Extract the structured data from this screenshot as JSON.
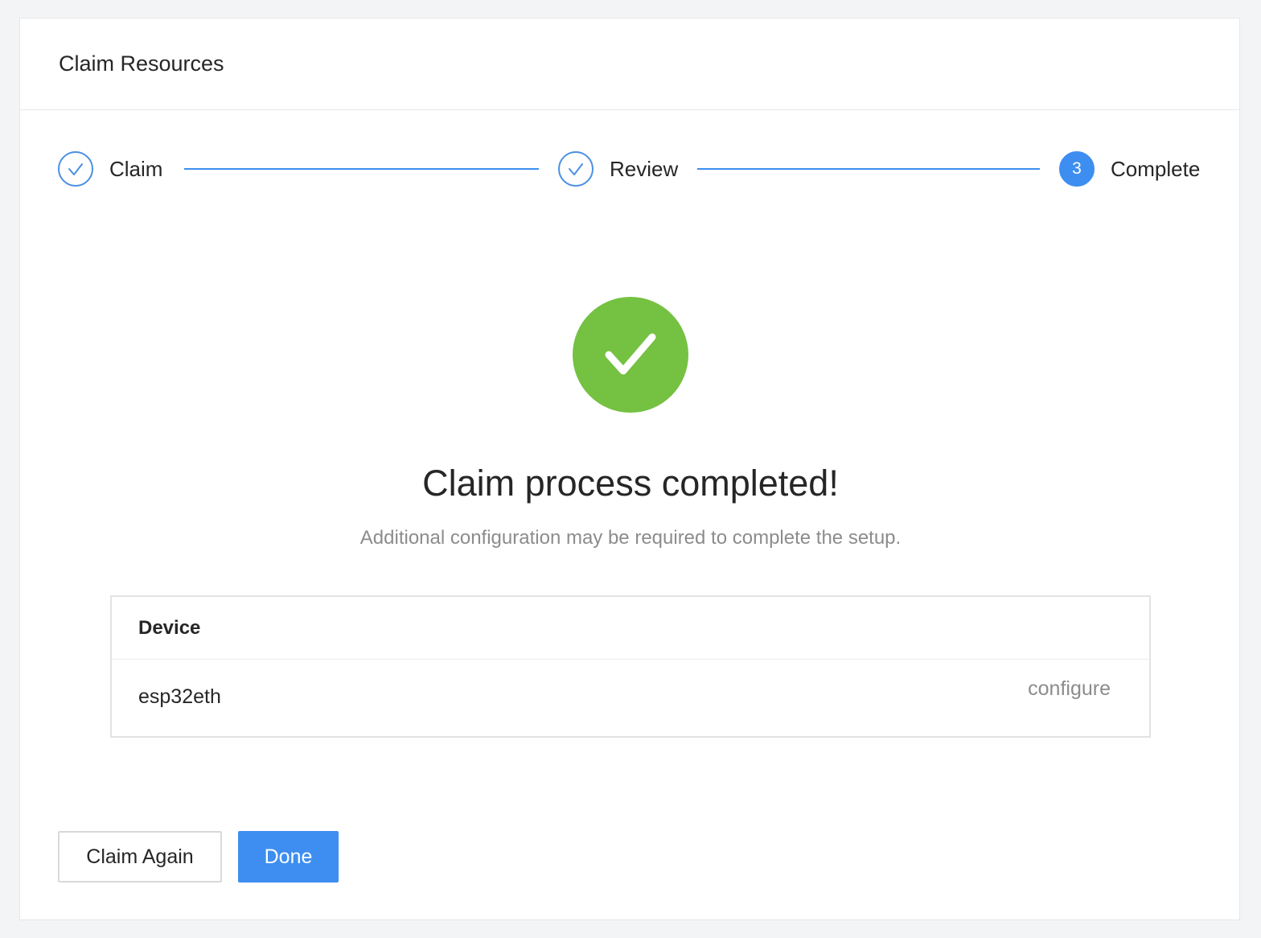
{
  "header": {
    "title": "Claim Resources"
  },
  "steps": [
    {
      "label": "Claim",
      "status": "done",
      "icon": "check-icon"
    },
    {
      "label": "Review",
      "status": "done",
      "icon": "check-icon"
    },
    {
      "label": "Complete",
      "status": "active",
      "number": "3"
    }
  ],
  "result": {
    "icon": "success-check-icon",
    "title": "Claim process completed!",
    "subtitle": "Additional configuration may be required to complete the setup."
  },
  "device_table": {
    "header": "Device",
    "rows": [
      {
        "name": "esp32eth",
        "action": "configure"
      }
    ]
  },
  "buttons": {
    "claim_again": "Claim Again",
    "done": "Done"
  },
  "colors": {
    "accent": "#3d8ef0",
    "success": "#75c142",
    "muted_text": "#8c8c8c"
  }
}
